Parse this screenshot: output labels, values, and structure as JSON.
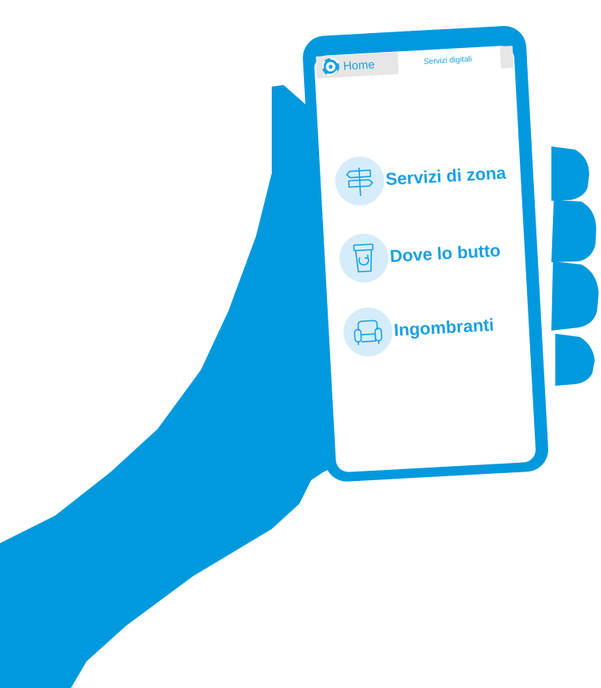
{
  "colors": {
    "brand_blue": "#0199dd",
    "accent_text": "#1aa0e2",
    "icon_circle": "#d5ecfa",
    "tab_grey": "#e6e6e6"
  },
  "tabs": {
    "home": {
      "label": "Home",
      "icon": "recycle-logo-icon"
    },
    "servizi": {
      "label": "Servizi digitali"
    }
  },
  "menu": [
    {
      "label": "Servizi di zona",
      "icon": "signpost-icon"
    },
    {
      "label": "Dove lo butto",
      "icon": "recycle-bin-icon"
    },
    {
      "label": "Ingombranti",
      "icon": "armchair-icon"
    }
  ]
}
